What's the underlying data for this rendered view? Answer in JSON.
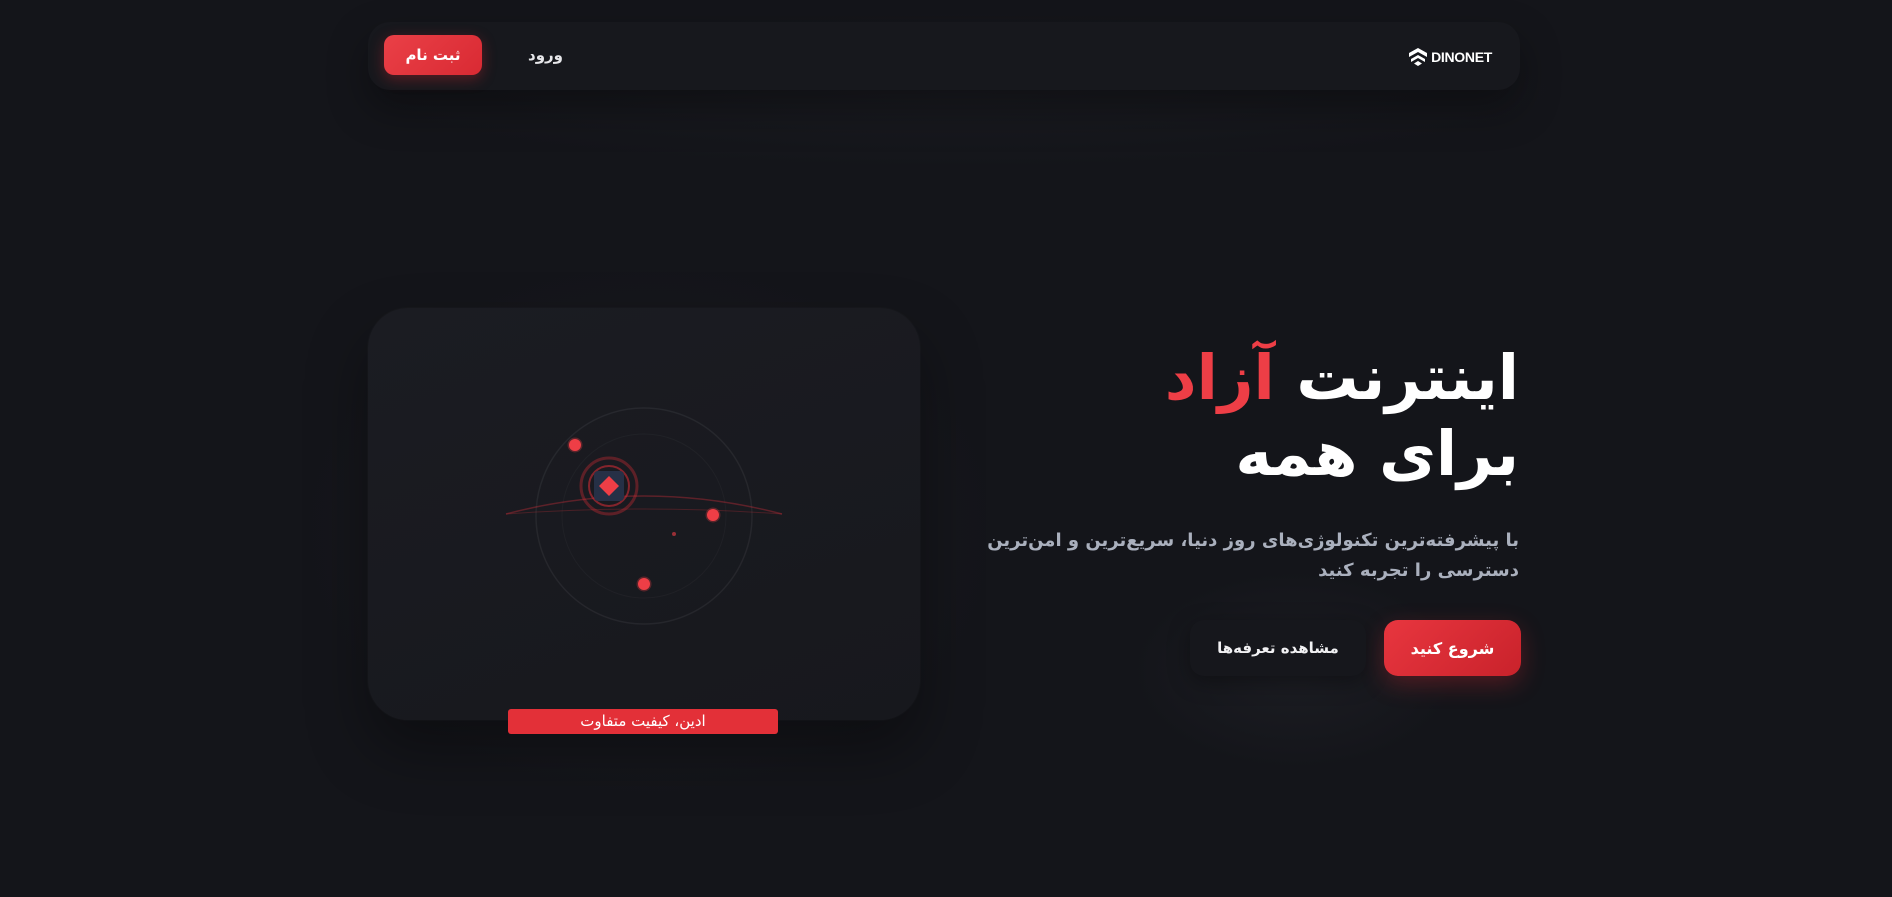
{
  "brand": {
    "name": "DINONET",
    "logo_icon": "dinonet-logo-icon"
  },
  "nav": {
    "register_label": "ثبت نام",
    "login_label": "ورود"
  },
  "hero": {
    "title_part1": "اینترنت",
    "title_accent": "آزاد",
    "title_line2": "برای همه",
    "subtitle": "با پیشرفته‌ترین تکنولوژی‌های روز دنیا، سریع‌ترین و امن‌ترین دسترسی را تجربه کنید",
    "cta_primary": "شروع کنید",
    "cta_secondary": "مشاهده تعرفه‌ها"
  },
  "visual": {
    "caption": "ادین، کیفیت متفاوت",
    "center_icon": "diamond-icon"
  },
  "colors": {
    "background": "#14151a",
    "accent": "#ee3e46",
    "surface": "#17181d",
    "muted_text": "#aab0bd"
  }
}
